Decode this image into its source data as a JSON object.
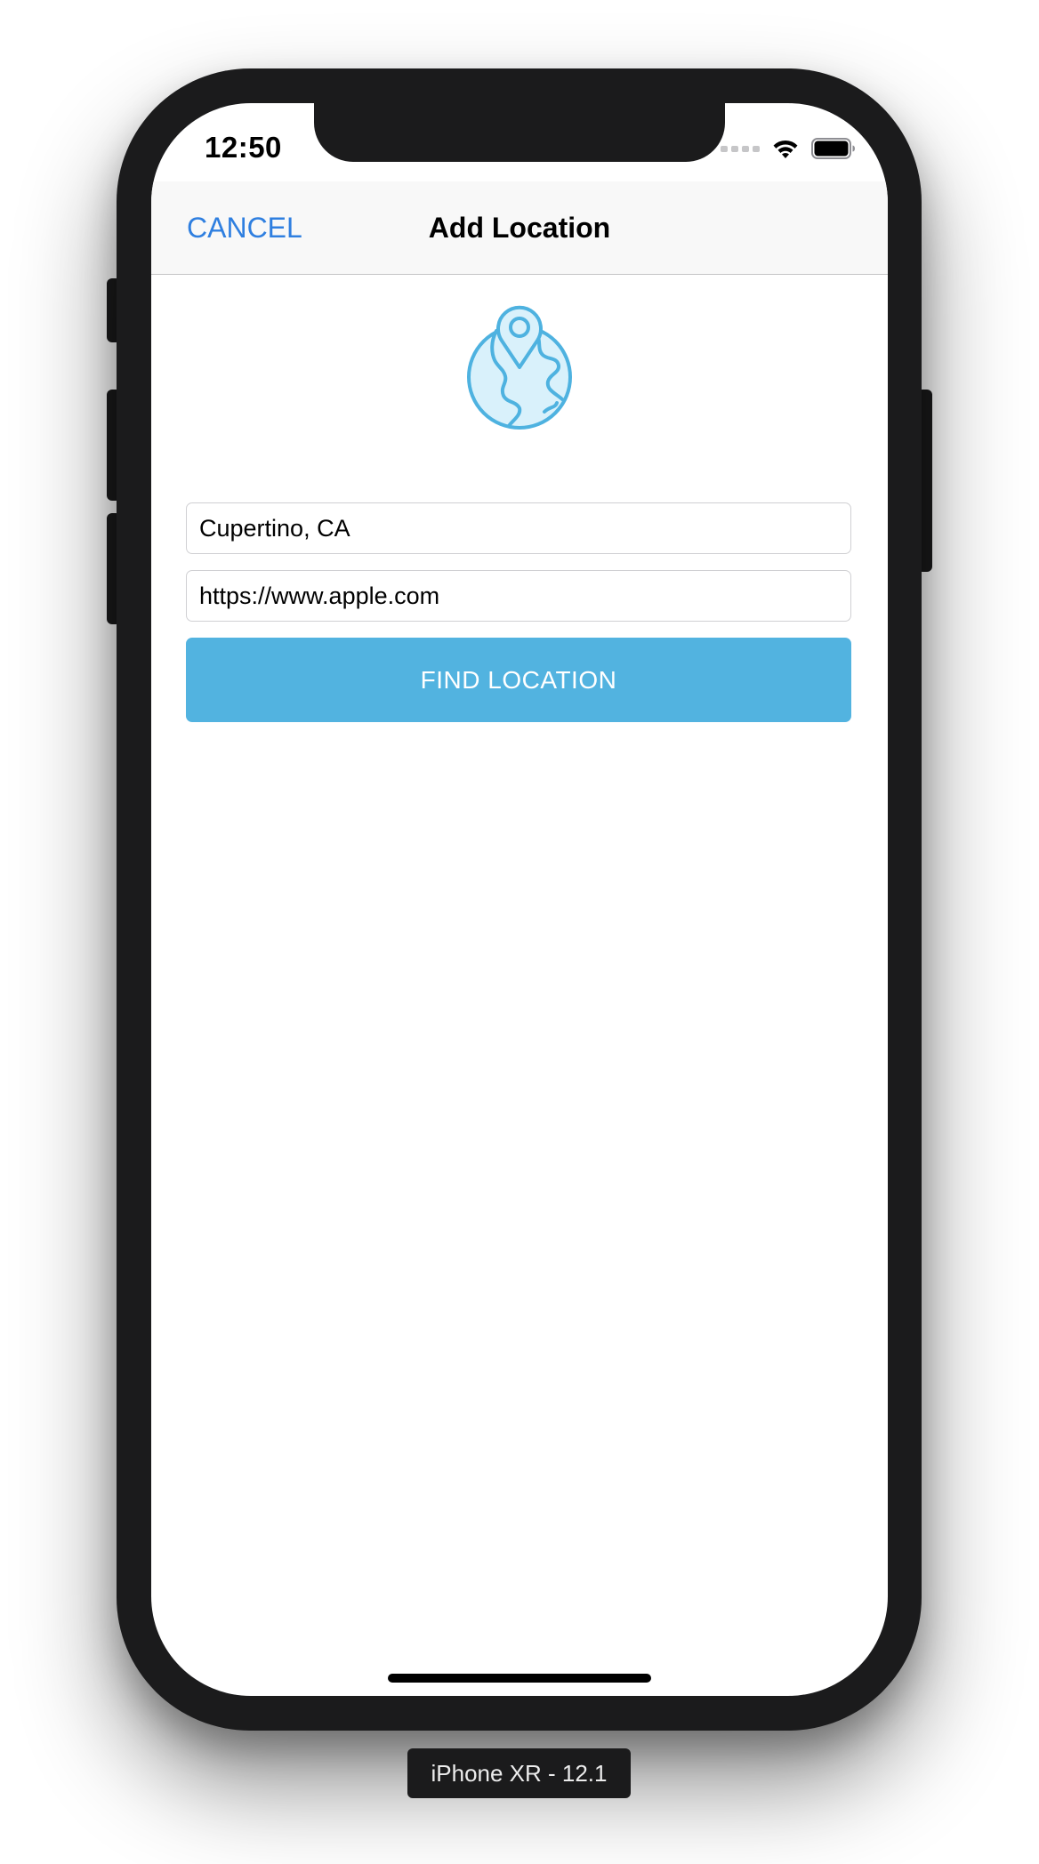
{
  "status_bar": {
    "time": "12:50"
  },
  "navbar": {
    "cancel_label": "CANCEL",
    "title": "Add Location"
  },
  "form": {
    "location_value": "Cupertino, CA",
    "url_value": "https://www.apple.com",
    "submit_label": "FIND LOCATION"
  },
  "simulator": {
    "device_label": "iPhone XR - 12.1"
  },
  "colors": {
    "accent_blue": "#2f7fe0",
    "button_blue": "#52b3e0",
    "globe_stroke": "#4eb2e0",
    "globe_fill": "#d9f1fb"
  },
  "icons": {
    "header_icon": "globe-location-pin-icon",
    "status_icons": [
      "signal-dots-icon",
      "wifi-icon",
      "battery-icon"
    ]
  }
}
